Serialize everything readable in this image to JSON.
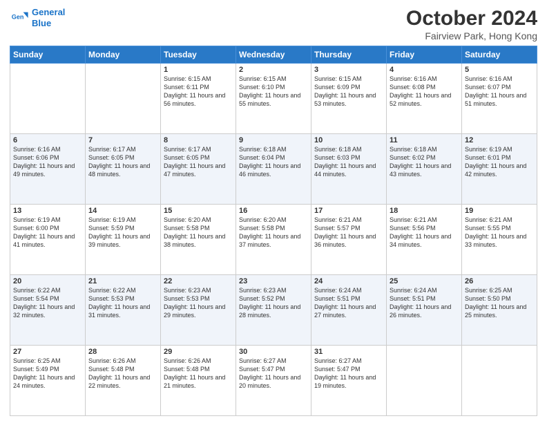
{
  "logo": {
    "line1": "General",
    "line2": "Blue"
  },
  "title": "October 2024",
  "subtitle": "Fairview Park, Hong Kong",
  "weekdays": [
    "Sunday",
    "Monday",
    "Tuesday",
    "Wednesday",
    "Thursday",
    "Friday",
    "Saturday"
  ],
  "weeks": [
    [
      {
        "day": "",
        "info": ""
      },
      {
        "day": "",
        "info": ""
      },
      {
        "day": "1",
        "info": "Sunrise: 6:15 AM\nSunset: 6:11 PM\nDaylight: 11 hours and 56 minutes."
      },
      {
        "day": "2",
        "info": "Sunrise: 6:15 AM\nSunset: 6:10 PM\nDaylight: 11 hours and 55 minutes."
      },
      {
        "day": "3",
        "info": "Sunrise: 6:15 AM\nSunset: 6:09 PM\nDaylight: 11 hours and 53 minutes."
      },
      {
        "day": "4",
        "info": "Sunrise: 6:16 AM\nSunset: 6:08 PM\nDaylight: 11 hours and 52 minutes."
      },
      {
        "day": "5",
        "info": "Sunrise: 6:16 AM\nSunset: 6:07 PM\nDaylight: 11 hours and 51 minutes."
      }
    ],
    [
      {
        "day": "6",
        "info": "Sunrise: 6:16 AM\nSunset: 6:06 PM\nDaylight: 11 hours and 49 minutes."
      },
      {
        "day": "7",
        "info": "Sunrise: 6:17 AM\nSunset: 6:05 PM\nDaylight: 11 hours and 48 minutes."
      },
      {
        "day": "8",
        "info": "Sunrise: 6:17 AM\nSunset: 6:05 PM\nDaylight: 11 hours and 47 minutes."
      },
      {
        "day": "9",
        "info": "Sunrise: 6:18 AM\nSunset: 6:04 PM\nDaylight: 11 hours and 46 minutes."
      },
      {
        "day": "10",
        "info": "Sunrise: 6:18 AM\nSunset: 6:03 PM\nDaylight: 11 hours and 44 minutes."
      },
      {
        "day": "11",
        "info": "Sunrise: 6:18 AM\nSunset: 6:02 PM\nDaylight: 11 hours and 43 minutes."
      },
      {
        "day": "12",
        "info": "Sunrise: 6:19 AM\nSunset: 6:01 PM\nDaylight: 11 hours and 42 minutes."
      }
    ],
    [
      {
        "day": "13",
        "info": "Sunrise: 6:19 AM\nSunset: 6:00 PM\nDaylight: 11 hours and 41 minutes."
      },
      {
        "day": "14",
        "info": "Sunrise: 6:19 AM\nSunset: 5:59 PM\nDaylight: 11 hours and 39 minutes."
      },
      {
        "day": "15",
        "info": "Sunrise: 6:20 AM\nSunset: 5:58 PM\nDaylight: 11 hours and 38 minutes."
      },
      {
        "day": "16",
        "info": "Sunrise: 6:20 AM\nSunset: 5:58 PM\nDaylight: 11 hours and 37 minutes."
      },
      {
        "day": "17",
        "info": "Sunrise: 6:21 AM\nSunset: 5:57 PM\nDaylight: 11 hours and 36 minutes."
      },
      {
        "day": "18",
        "info": "Sunrise: 6:21 AM\nSunset: 5:56 PM\nDaylight: 11 hours and 34 minutes."
      },
      {
        "day": "19",
        "info": "Sunrise: 6:21 AM\nSunset: 5:55 PM\nDaylight: 11 hours and 33 minutes."
      }
    ],
    [
      {
        "day": "20",
        "info": "Sunrise: 6:22 AM\nSunset: 5:54 PM\nDaylight: 11 hours and 32 minutes."
      },
      {
        "day": "21",
        "info": "Sunrise: 6:22 AM\nSunset: 5:53 PM\nDaylight: 11 hours and 31 minutes."
      },
      {
        "day": "22",
        "info": "Sunrise: 6:23 AM\nSunset: 5:53 PM\nDaylight: 11 hours and 29 minutes."
      },
      {
        "day": "23",
        "info": "Sunrise: 6:23 AM\nSunset: 5:52 PM\nDaylight: 11 hours and 28 minutes."
      },
      {
        "day": "24",
        "info": "Sunrise: 6:24 AM\nSunset: 5:51 PM\nDaylight: 11 hours and 27 minutes."
      },
      {
        "day": "25",
        "info": "Sunrise: 6:24 AM\nSunset: 5:51 PM\nDaylight: 11 hours and 26 minutes."
      },
      {
        "day": "26",
        "info": "Sunrise: 6:25 AM\nSunset: 5:50 PM\nDaylight: 11 hours and 25 minutes."
      }
    ],
    [
      {
        "day": "27",
        "info": "Sunrise: 6:25 AM\nSunset: 5:49 PM\nDaylight: 11 hours and 24 minutes."
      },
      {
        "day": "28",
        "info": "Sunrise: 6:26 AM\nSunset: 5:48 PM\nDaylight: 11 hours and 22 minutes."
      },
      {
        "day": "29",
        "info": "Sunrise: 6:26 AM\nSunset: 5:48 PM\nDaylight: 11 hours and 21 minutes."
      },
      {
        "day": "30",
        "info": "Sunrise: 6:27 AM\nSunset: 5:47 PM\nDaylight: 11 hours and 20 minutes."
      },
      {
        "day": "31",
        "info": "Sunrise: 6:27 AM\nSunset: 5:47 PM\nDaylight: 11 hours and 19 minutes."
      },
      {
        "day": "",
        "info": ""
      },
      {
        "day": "",
        "info": ""
      }
    ]
  ]
}
